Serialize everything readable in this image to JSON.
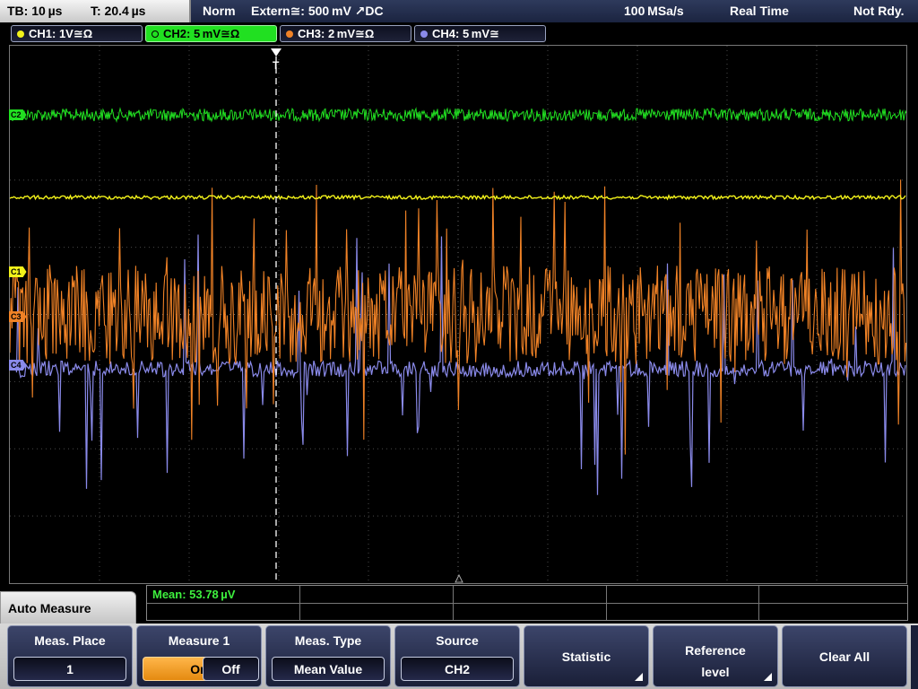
{
  "top_bar": {
    "timebase": "TB: 10 µs",
    "trigger_time": "T: 20.4 µs",
    "mode": "Norm",
    "trigger_source": "Extern≅: 500 mV ↗DC",
    "sample_rate": "100 MSa/s",
    "acquisition": "Real Time",
    "status": "Not Rdy."
  },
  "channels": [
    {
      "label": "CH1: 1V≅Ω",
      "color": "#f2f21a",
      "active": false
    },
    {
      "label": "CH2: 5 mV≅Ω",
      "color": "#21e021",
      "active": true
    },
    {
      "label": "CH3: 2 mV≅Ω",
      "color": "#f08226",
      "active": false
    },
    {
      "label": "CH4: 5 mV≅",
      "color": "#8a8aea",
      "active": false
    }
  ],
  "markers": {
    "c1": "C1",
    "c2": "C2",
    "c3": "C3",
    "c4": "C4",
    "trigger": "T"
  },
  "measurement": {
    "mean": "Mean: 53.78 µV"
  },
  "menu": {
    "title": "Auto Measure",
    "meas_place": {
      "label": "Meas. Place",
      "value": "1"
    },
    "measure1": {
      "label": "Measure 1",
      "on": "On",
      "off": "Off"
    },
    "meas_type": {
      "label": "Meas. Type",
      "value": "Mean Value"
    },
    "source": {
      "label": "Source",
      "value": "CH2"
    },
    "statistic": {
      "label": "Statistic"
    },
    "reference_level": {
      "line1": "Reference",
      "line2": "level"
    },
    "clear_all": {
      "label": "Clear All"
    }
  }
}
